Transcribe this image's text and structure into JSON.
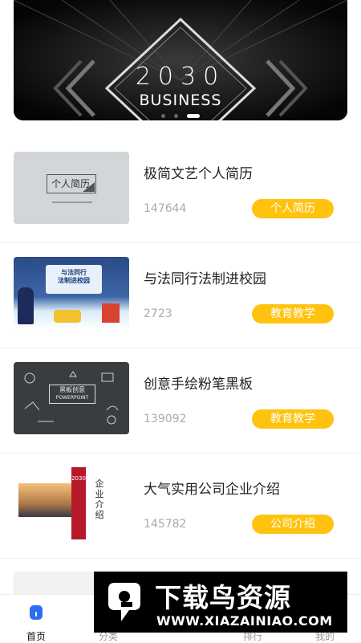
{
  "banner": {
    "year": "2030",
    "subtitle": "BUSINESS",
    "dots_count": 3,
    "active_dot_index": 2
  },
  "list": [
    {
      "title": "极简文艺个人简历",
      "count": "147644",
      "tag": "个人简历",
      "thumb_text": "个人简历"
    },
    {
      "title": "与法同行法制进校园",
      "count": "2723",
      "tag": "教育教学",
      "thumb_line1": "与法同行",
      "thumb_line2": "法制进校园"
    },
    {
      "title": "创意手绘粉笔黑板",
      "count": "139092",
      "tag": "教育教学",
      "thumb_line1": "黑板创意",
      "thumb_line2": "POWERPOINT"
    },
    {
      "title": "大气实用公司企业介绍",
      "count": "145782",
      "tag": "公司介绍",
      "thumb_year": "2030",
      "thumb_vertical": "企业介绍"
    }
  ],
  "tabs": [
    {
      "label": "首页",
      "icon": "home-icon",
      "active": true
    },
    {
      "label": "分类",
      "icon": "category-icon",
      "active": false
    },
    {
      "label": "排行",
      "icon": "ranking-icon",
      "active": false
    },
    {
      "label": "我的",
      "icon": "profile-icon",
      "active": false
    }
  ],
  "watermark": {
    "title": "下载鸟资源",
    "url": "WWW.XIAZAINIAO.COM"
  },
  "colors": {
    "accent": "#ffc30f",
    "banner_bg": "#0d0d0d",
    "watermark_bg": "#000000"
  }
}
